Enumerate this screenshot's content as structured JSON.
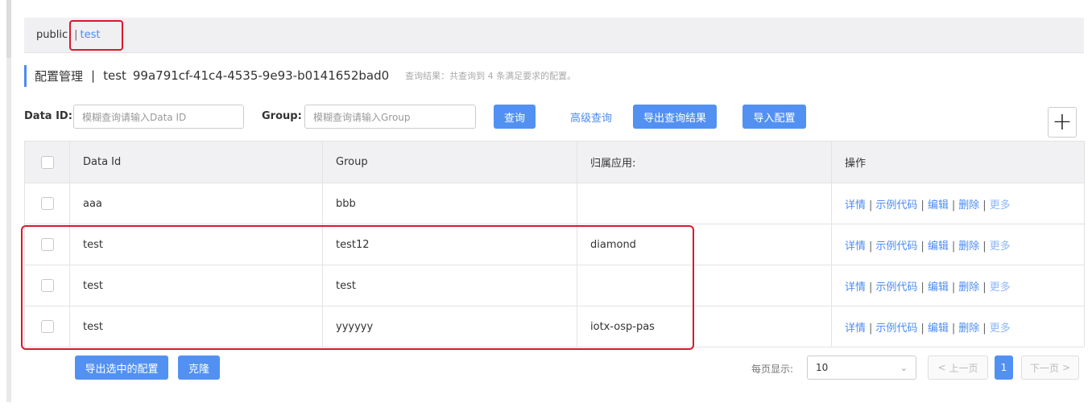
{
  "namespaces": {
    "items": [
      "public",
      "test"
    ],
    "separator": "|",
    "active": "test"
  },
  "title": {
    "label": "配置管理",
    "separator": "|",
    "namespace": "test",
    "namespace_id": "99a791cf-41c4-4535-9e93-b0141652bad0",
    "result": "查询结果：共查询到 4 条满足要求的配置。"
  },
  "search": {
    "data_id_label": "Data ID:",
    "data_id_placeholder": "模糊查询请输入Data ID",
    "group_label": "Group:",
    "group_placeholder": "模糊查询请输入Group",
    "query_button": "查询",
    "advanced_query": "高级查询",
    "export_results_button": "导出查询结果",
    "import_button": "导入配置",
    "add_icon": "plus-icon"
  },
  "table": {
    "headers": {
      "data_id": "Data Id",
      "group": "Group",
      "app": "归属应用:",
      "ops": "操作"
    },
    "ops": {
      "detail": "详情",
      "sample": "示例代码",
      "edit": "编辑",
      "delete": "删除",
      "more": "更多",
      "separator": "|"
    },
    "rows": [
      {
        "data_id": "aaa",
        "group": "bbb",
        "app": ""
      },
      {
        "data_id": "test",
        "group": "test12",
        "app": "diamond"
      },
      {
        "data_id": "test",
        "group": "test",
        "app": ""
      },
      {
        "data_id": "test",
        "group": "yyyyyy",
        "app": "iotx-osp-pas"
      }
    ]
  },
  "footer": {
    "export_selected_button": "导出选中的配置",
    "clone_button": "克隆",
    "per_page_label": "每页显示:",
    "per_page_value": "10",
    "prev_page": "上一页",
    "current_page": "1",
    "next_page": "下一页"
  },
  "colors": {
    "accent": "#5291f2",
    "highlight": "#d9182d"
  }
}
